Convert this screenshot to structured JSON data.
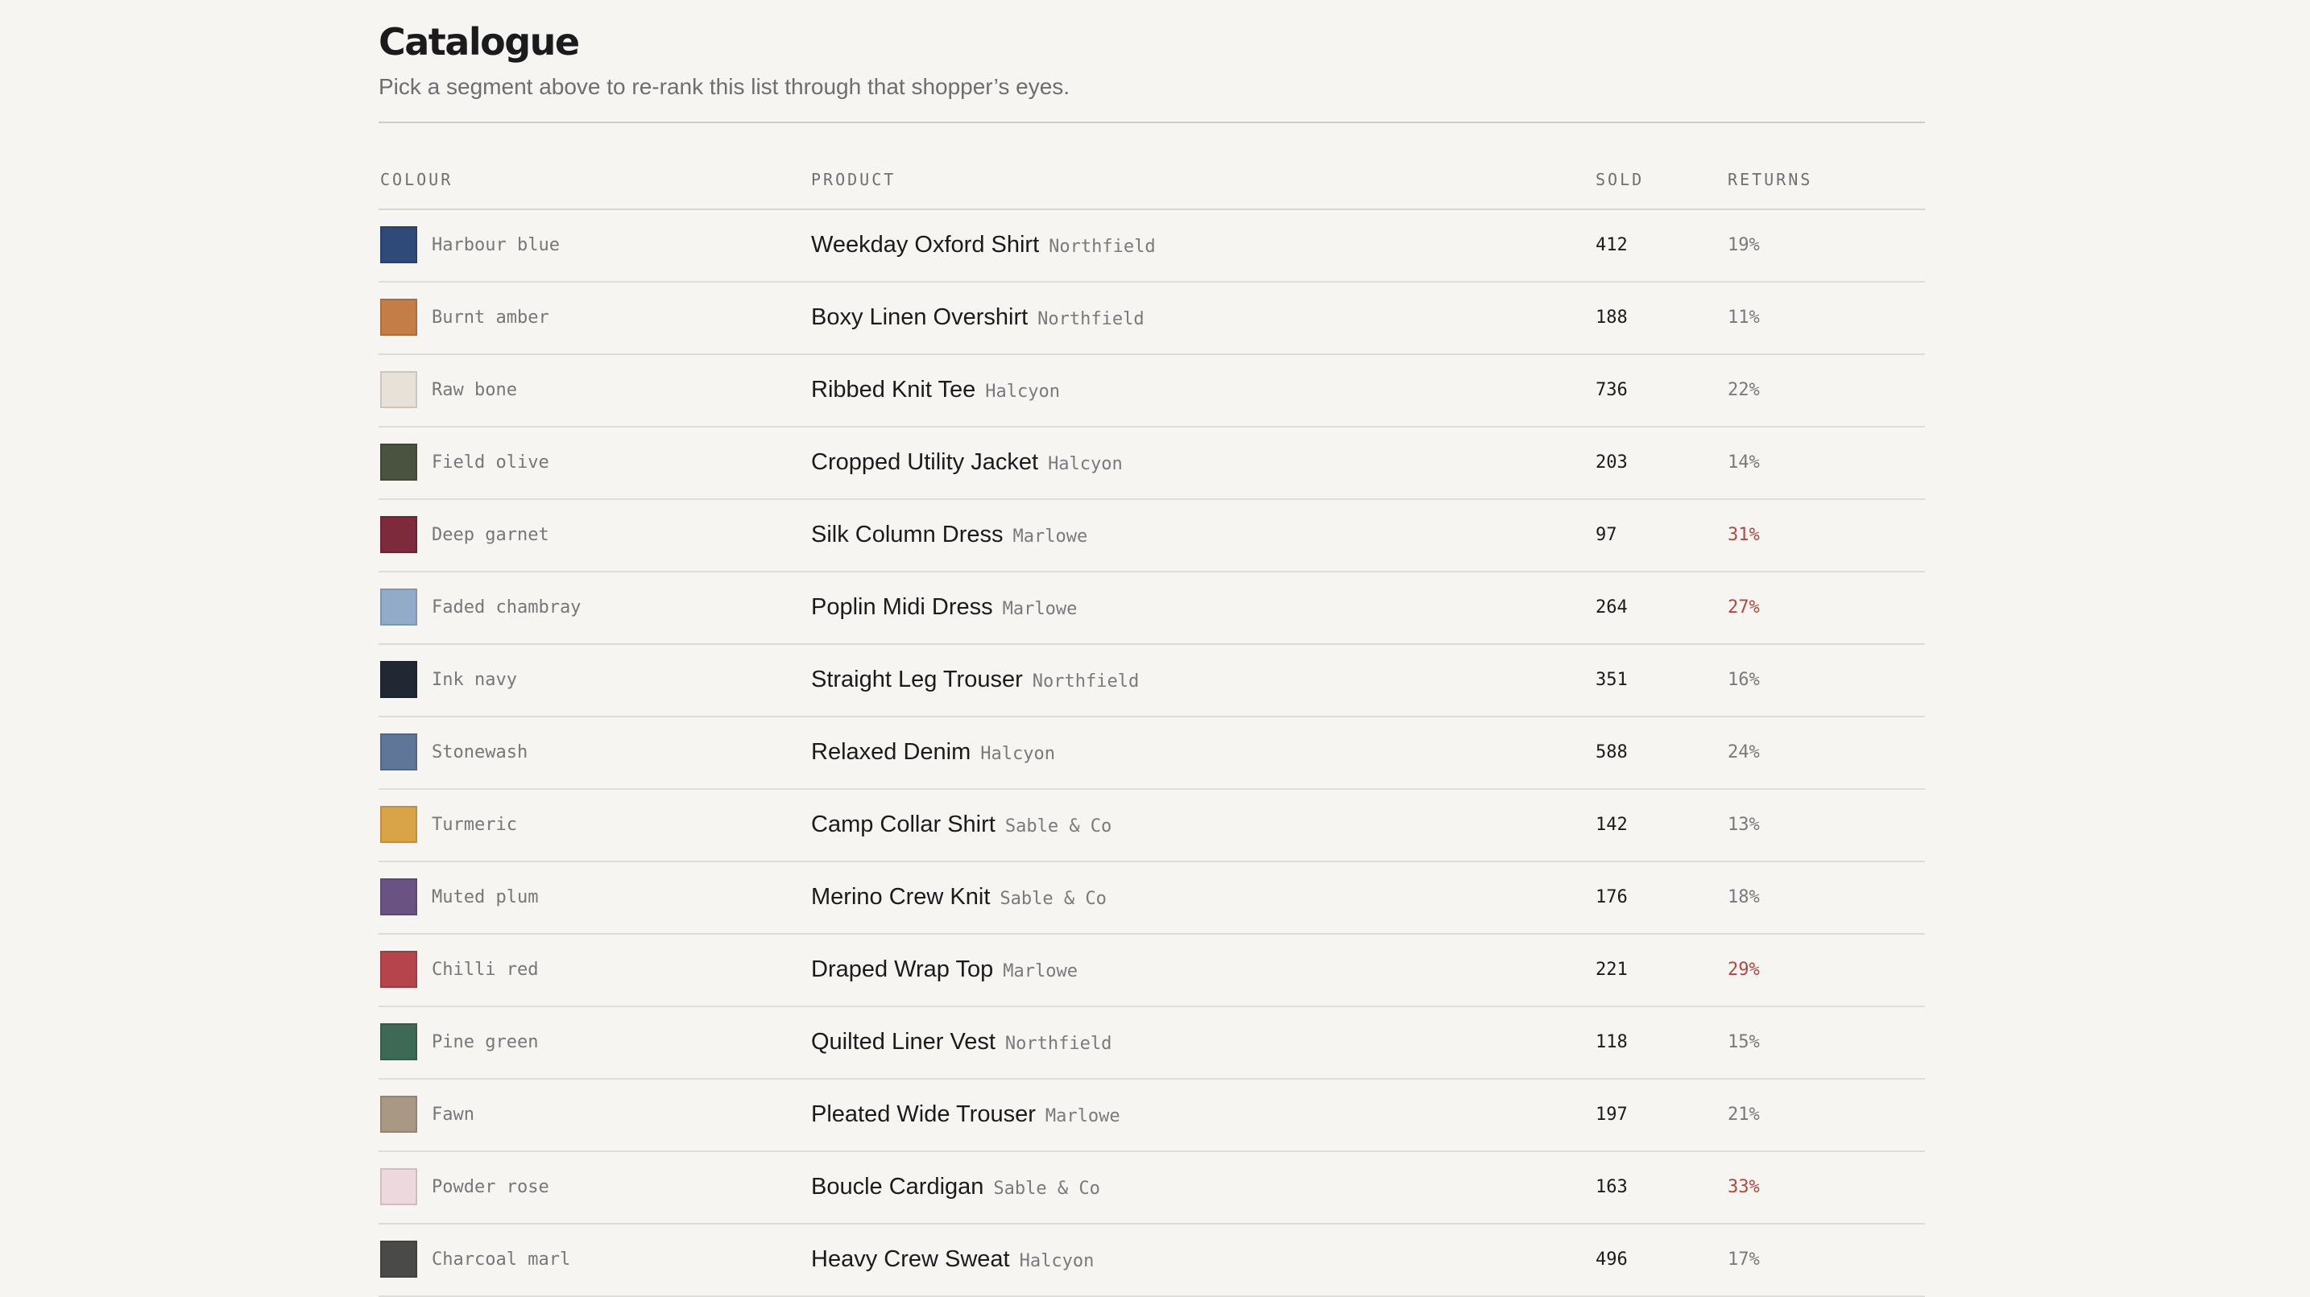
{
  "header": {
    "title": "Catalogue",
    "subtitle": "Pick a segment above to re-rank this list through that shopper’s eyes."
  },
  "table": {
    "columns": {
      "colour": "COLOUR",
      "product": "PRODUCT",
      "sold": "SOLD",
      "returns": "RETURNS"
    },
    "rows": [
      {
        "colour_name": "Harbour blue",
        "swatch": "#2f4a78",
        "product": "Weekday Oxford Shirt",
        "brand": "Northfield",
        "sold": "412",
        "returns": "19%",
        "returns_high": false
      },
      {
        "colour_name": "Burnt amber",
        "swatch": "#c47d46",
        "product": "Boxy Linen Overshirt",
        "brand": "Northfield",
        "sold": "188",
        "returns": "11%",
        "returns_high": false
      },
      {
        "colour_name": "Raw bone",
        "swatch": "#e7e1d8",
        "product": "Ribbed Knit Tee",
        "brand": "Halcyon",
        "sold": "736",
        "returns": "22%",
        "returns_high": false
      },
      {
        "colour_name": "Field olive",
        "swatch": "#4a5340",
        "product": "Cropped Utility Jacket",
        "brand": "Halcyon",
        "sold": "203",
        "returns": "14%",
        "returns_high": false
      },
      {
        "colour_name": "Deep garnet",
        "swatch": "#7c2a3c",
        "product": "Silk Column Dress",
        "brand": "Marlowe",
        "sold": "97",
        "returns": "31%",
        "returns_high": true
      },
      {
        "colour_name": "Faded chambray",
        "swatch": "#91abc8",
        "product": "Poplin Midi Dress",
        "brand": "Marlowe",
        "sold": "264",
        "returns": "27%",
        "returns_high": true
      },
      {
        "colour_name": "Ink navy",
        "swatch": "#222833",
        "product": "Straight Leg Trouser",
        "brand": "Northfield",
        "sold": "351",
        "returns": "16%",
        "returns_high": false
      },
      {
        "colour_name": "Stonewash",
        "swatch": "#5f7698",
        "product": "Relaxed Denim",
        "brand": "Halcyon",
        "sold": "588",
        "returns": "24%",
        "returns_high": false
      },
      {
        "colour_name": "Turmeric",
        "swatch": "#d9a347",
        "product": "Camp Collar Shirt",
        "brand": "Sable & Co",
        "sold": "142",
        "returns": "13%",
        "returns_high": false
      },
      {
        "colour_name": "Muted plum",
        "swatch": "#6a5283",
        "product": "Merino Crew Knit",
        "brand": "Sable & Co",
        "sold": "176",
        "returns": "18%",
        "returns_high": false
      },
      {
        "colour_name": "Chilli red",
        "swatch": "#b5444d",
        "product": "Draped Wrap Top",
        "brand": "Marlowe",
        "sold": "221",
        "returns": "29%",
        "returns_high": true
      },
      {
        "colour_name": "Pine green",
        "swatch": "#3d6955",
        "product": "Quilted Liner Vest",
        "brand": "Northfield",
        "sold": "118",
        "returns": "15%",
        "returns_high": false
      },
      {
        "colour_name": "Fawn",
        "swatch": "#a89884",
        "product": "Pleated Wide Trouser",
        "brand": "Marlowe",
        "sold": "197",
        "returns": "21%",
        "returns_high": false
      },
      {
        "colour_name": "Powder rose",
        "swatch": "#ecd8dd",
        "product": "Boucle Cardigan",
        "brand": "Sable & Co",
        "sold": "163",
        "returns": "33%",
        "returns_high": true
      },
      {
        "colour_name": "Charcoal marl",
        "swatch": "#4a4b48",
        "product": "Heavy Crew Sweat",
        "brand": "Halcyon",
        "sold": "496",
        "returns": "17%",
        "returns_high": false
      }
    ]
  }
}
